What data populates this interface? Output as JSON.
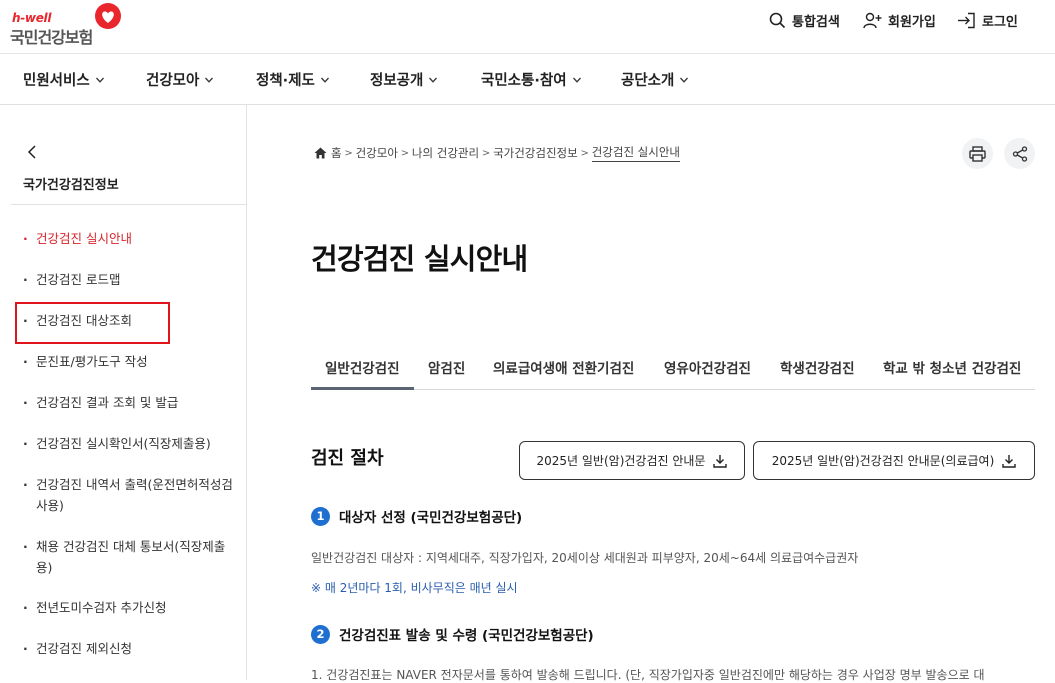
{
  "header": {
    "logo_tagline": "h-well",
    "logo_org": "국민건강보험",
    "search_label": "통합검색",
    "signup_label": "회원가입",
    "login_label": "로그인"
  },
  "gnb": [
    {
      "label": "민원서비스"
    },
    {
      "label": "건강모아"
    },
    {
      "label": "정책·제도"
    },
    {
      "label": "정보공개"
    },
    {
      "label": "국민소통·참여"
    },
    {
      "label": "공단소개"
    }
  ],
  "sidebar": {
    "title": "국가건강검진정보",
    "items": [
      {
        "label": "건강검진 실시안내",
        "active": true
      },
      {
        "label": "건강검진 로드맵"
      },
      {
        "label": "건강검진 대상조회"
      },
      {
        "label": "문진표/평가도구 작성"
      },
      {
        "label": "건강검진 결과 조회 및 발급"
      },
      {
        "label": "건강검진 실시확인서(직장제출용)"
      },
      {
        "label": "건강검진 내역서 출력(운전면허적성검사용)"
      },
      {
        "label": "채용 건강검진 대체 통보서(직장제출용)"
      },
      {
        "label": "전년도미수검자 추가신청"
      },
      {
        "label": "건강검진 제외신청"
      }
    ]
  },
  "breadcrumb": [
    "홈",
    "건강모아",
    "나의 건강관리",
    "국가건강검진정보",
    "건강검진 실시안내"
  ],
  "page_title": "건강검진 실시안내",
  "tabs": [
    {
      "label": "일반건강검진",
      "active": true
    },
    {
      "label": "암검진"
    },
    {
      "label": "의료급여생애 전환기검진"
    },
    {
      "label": "영유아건강검진"
    },
    {
      "label": "학생건강검진"
    },
    {
      "label": "학교 밖 청소년 건강검진"
    }
  ],
  "section": {
    "title": "검진 절차",
    "download_1": "2025년 일반(암)건강검진 안내문",
    "download_2": "2025년 일반(암)건강검진 안내문(의료급여)"
  },
  "steps": [
    {
      "num": "1",
      "title": "대상자 선정 (국민건강보험공단)",
      "text": "일반건강검진 대상자 : 지역세대주, 직장가입자, 20세이상 세대원과 피부양자, 20세~64세 의료급여수급권자",
      "note": "※ 매 2년마다 1회, 비사무직은 매년 실시"
    },
    {
      "num": "2",
      "title": "건강검진표 발송 및 수령 (국민건강보험공단)",
      "text": "1. 건강검진표는 NAVER 전자문서를 통하여 발송해 드립니다. (단, 직장가입자중 일반검진에만 해당하는 경우 사업장 명부 발송으로 대"
    }
  ],
  "colors": {
    "brand_red": "#e8262c",
    "active_red": "#d8242c",
    "step_blue": "#1f6fd1",
    "note_blue": "#2a5db0",
    "highlight": "#e0141b"
  }
}
